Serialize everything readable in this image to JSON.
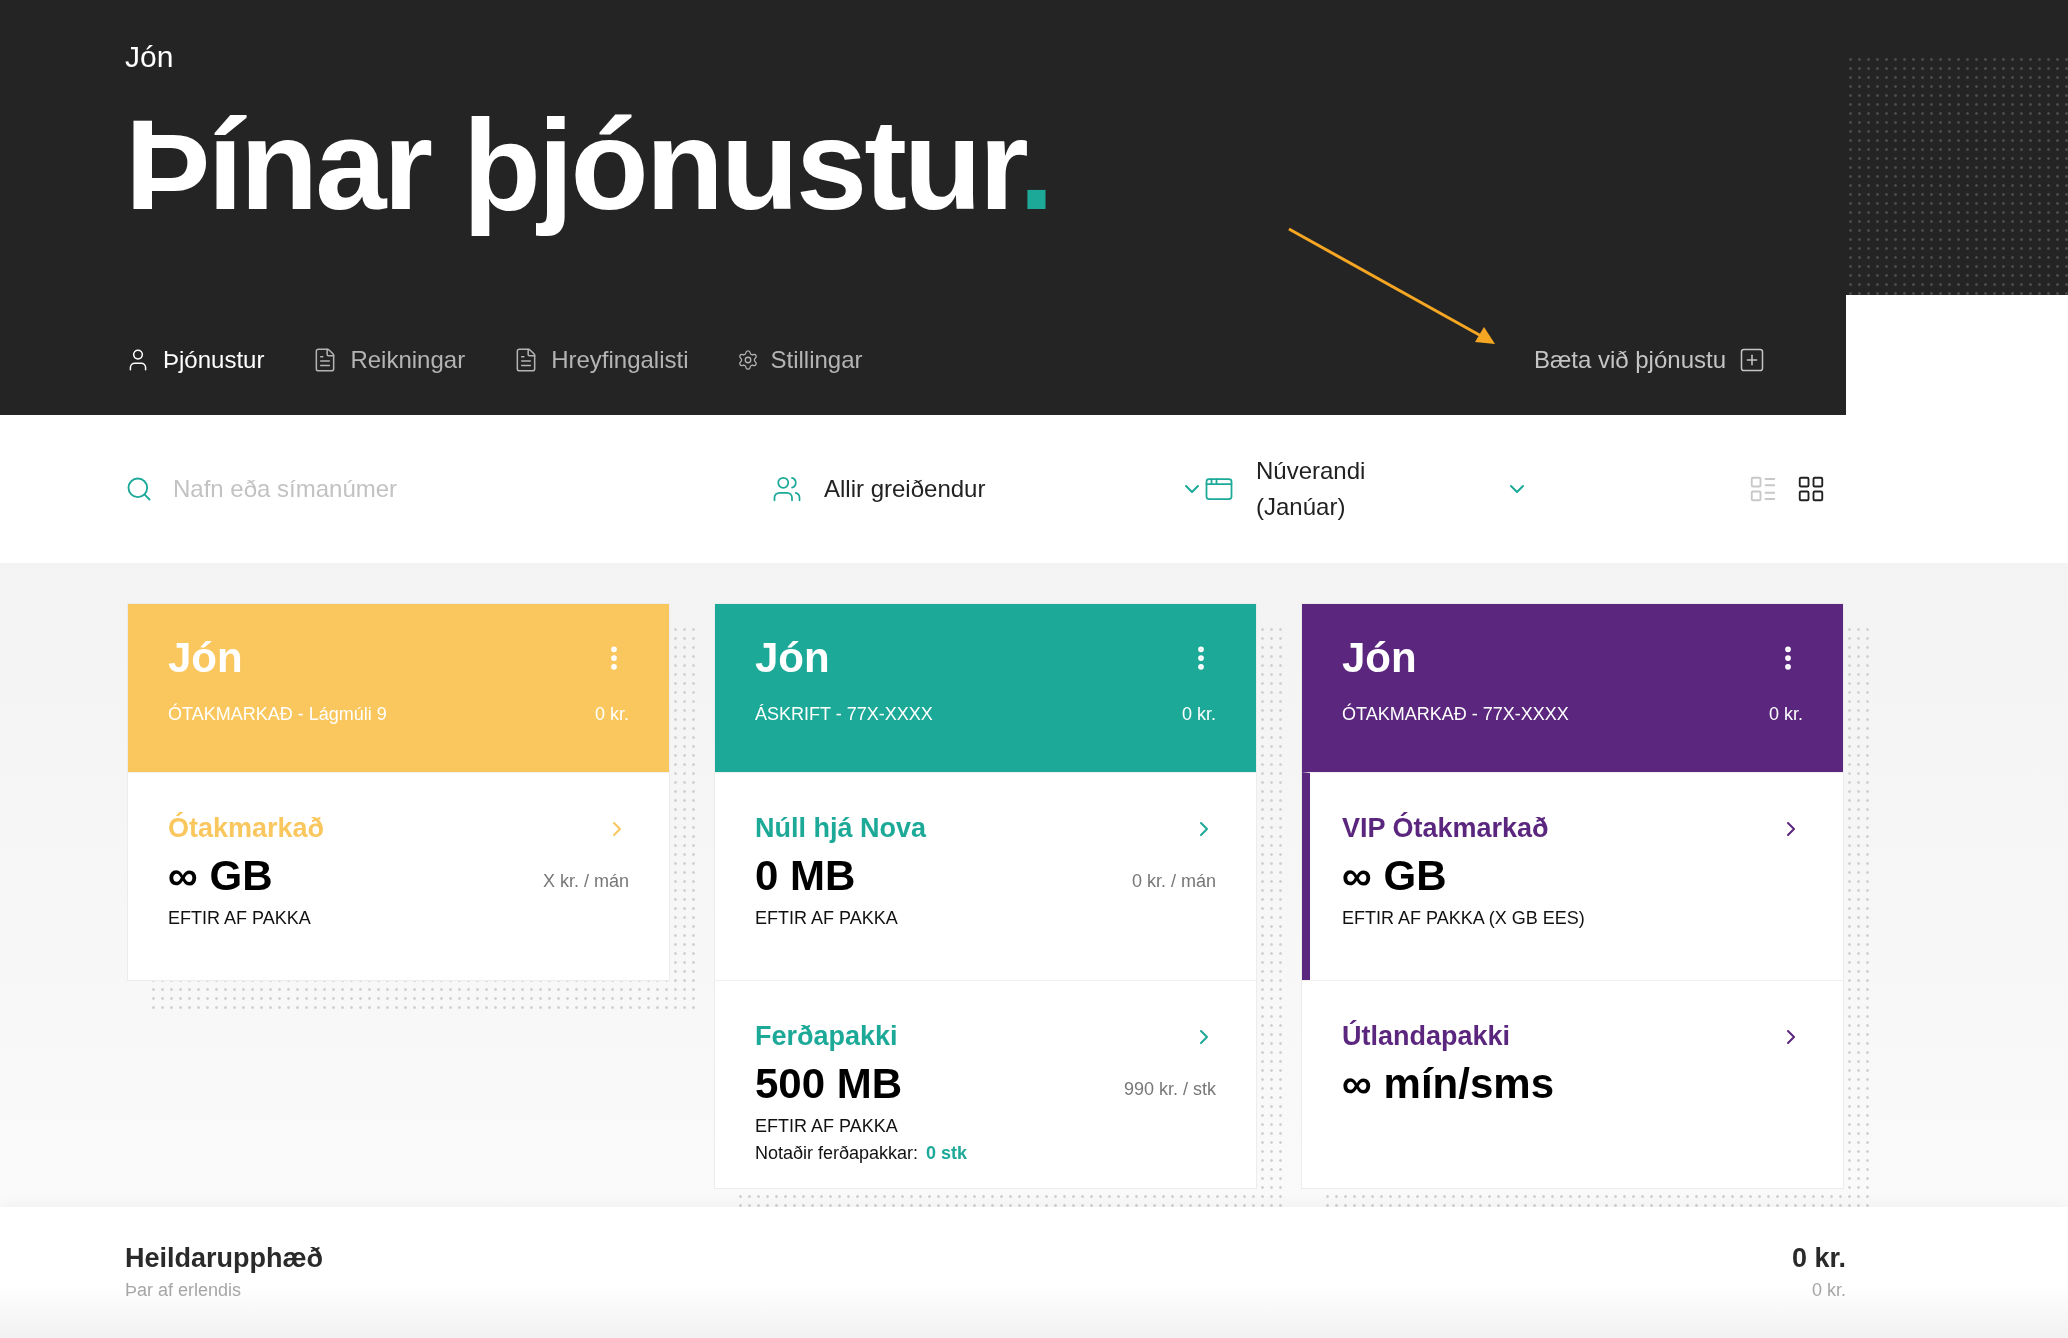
{
  "user_name": "Jón",
  "title": "Þínar þjónustur",
  "title_dot": ".",
  "nav": [
    {
      "kind": "user",
      "label": "Þjónustur",
      "selected": true
    },
    {
      "kind": "document",
      "label": "Reikningar",
      "selected": false
    },
    {
      "kind": "document",
      "label": "Hreyfingalisti",
      "selected": false
    },
    {
      "kind": "settings",
      "label": "Stillingar",
      "selected": false
    }
  ],
  "add_service": "Bæta við þjónustu",
  "filters": {
    "search": {
      "placeholder": "Nafn eða símanúmer"
    },
    "payer": "Allir greiðendur",
    "period": "Núverandi (Janúar)",
    "views": [
      {
        "kind": "list",
        "selected": false
      },
      {
        "kind": "grid",
        "selected": true
      }
    ]
  },
  "cards": [
    {
      "name": "Jón",
      "color": "#f9c75e",
      "subtitle": "ÓTAKMARKAÐ - Lágmúli 9",
      "amount": "0 kr.",
      "packages": [
        {
          "title": "Ótakmarkað",
          "value": "∞ GB",
          "label": "EFTIR AF PAKKA",
          "price": "X kr. / mán",
          "selected": false
        }
      ]
    },
    {
      "name": "Jón",
      "color": "#1ca998",
      "subtitle": "ÁSKRIFT - 77X-XXXX",
      "amount": "0 kr.",
      "packages": [
        {
          "title": "Núll hjá Nova",
          "value": "0 MB",
          "label": "EFTIR AF PAKKA",
          "price": "0 kr. / mán",
          "selected": false
        },
        {
          "title": "Ferðapakki",
          "value": "500 MB",
          "label": "EFTIR AF PAKKA",
          "price": "990 kr. / stk",
          "note": "Notaðir ferðapakkar:",
          "note_value": "0 stk",
          "selected": false
        }
      ]
    },
    {
      "name": "Jón",
      "color": "#5b267e",
      "subtitle": "ÓTAKMARKAÐ - 77X-XXXX",
      "amount": "0 kr.",
      "packages": [
        {
          "title": "VIP Ótakmarkað",
          "value": "∞ GB",
          "label": "EFTIR AF PAKKA (X GB EES)",
          "selected": true
        },
        {
          "title": "Útlandapakki",
          "value": "∞ mín/sms",
          "selected": false
        }
      ]
    }
  ],
  "total": {
    "label": "Heildarupphæð",
    "amount": "0 kr.",
    "sub_label": "Þar af erlendis",
    "sub_amount": "0 kr."
  }
}
